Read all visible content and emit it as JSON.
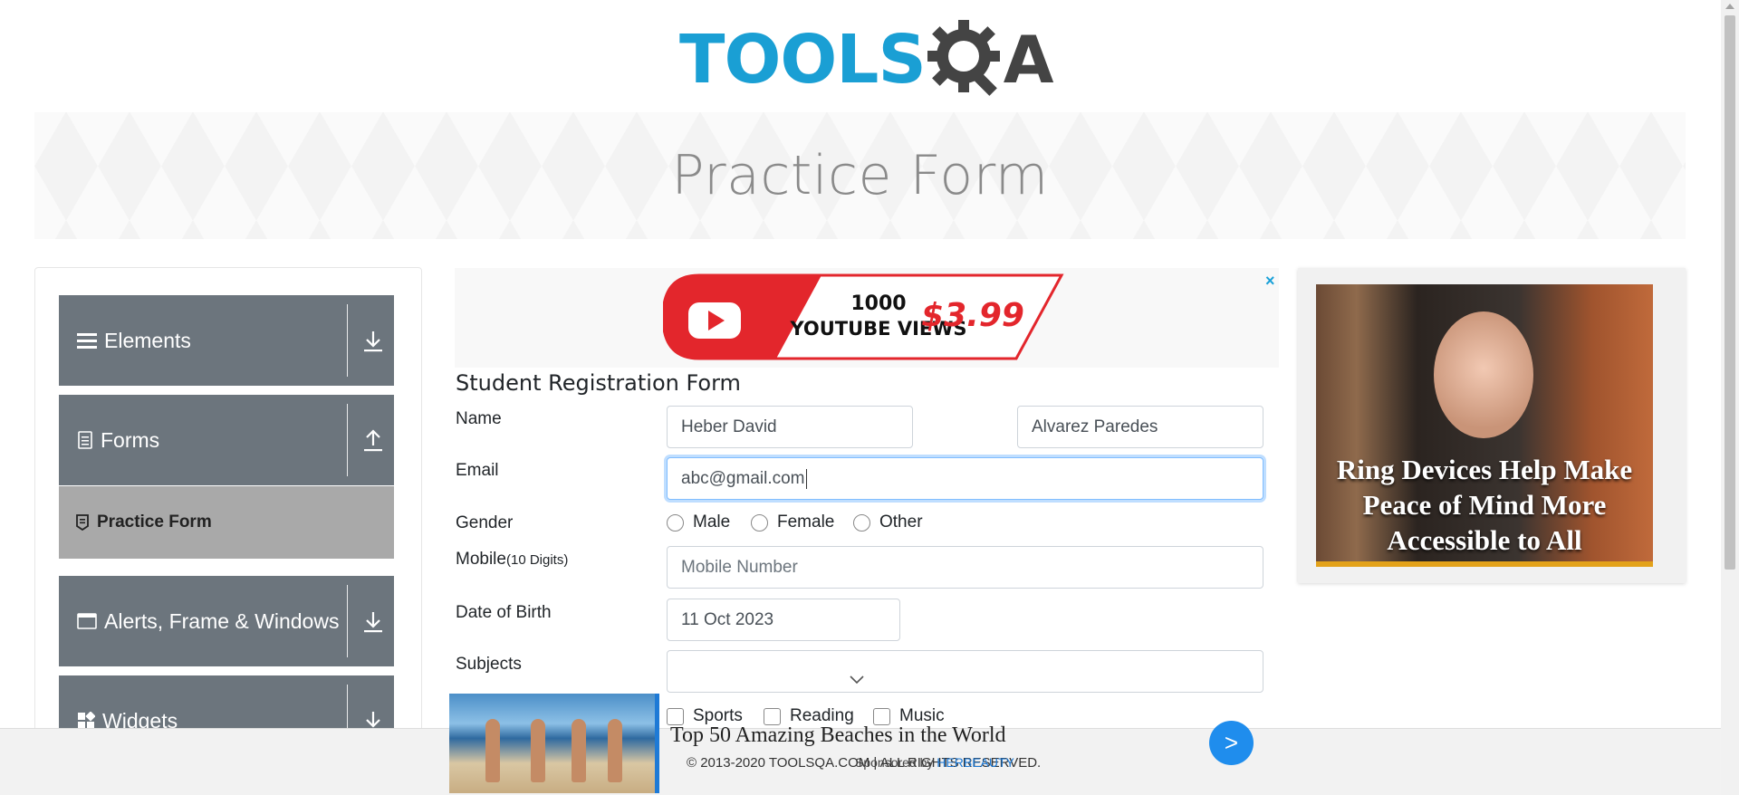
{
  "header": {
    "logo_tools": "TOOLS",
    "logo_a": "A",
    "logo_icon": "gear-magnifier-icon"
  },
  "banner": {
    "title": "Practice Form"
  },
  "sidebar": {
    "groups": [
      {
        "label": "Elements",
        "icon": "hamburger-icon",
        "state_icon": "download-arrow-icon"
      },
      {
        "label": "Forms",
        "icon": "document-icon",
        "state_icon": "upload-arrow-icon"
      },
      {
        "label": "Alerts, Frame & Windows",
        "icon": "window-icon",
        "state_icon": "download-arrow-icon"
      },
      {
        "label": "Widgets",
        "icon": "widgets-icon",
        "state_icon": "download-arrow-icon"
      }
    ],
    "active_item": {
      "label": "Practice Form",
      "icon": "badge-icon"
    }
  },
  "top_ad": {
    "close": "×",
    "line1": "1000",
    "line2": "YOUTUBE VIEWS",
    "price": "$3.99"
  },
  "form": {
    "title": "Student Registration Form",
    "name_label": "Name",
    "first_name": "Heber David",
    "last_name": "Alvarez Paredes",
    "email_label": "Email",
    "email": "abc@gmail.com",
    "gender_label": "Gender",
    "gender_options": [
      "Male",
      "Female",
      "Other"
    ],
    "mobile_label": "Mobile",
    "mobile_hint": "(10 Digits)",
    "mobile_placeholder": "Mobile Number",
    "dob_label": "Date of Birth",
    "dob": "11 Oct 2023",
    "subjects_label": "Subjects",
    "hobbies": [
      "Sports",
      "Reading",
      "Music"
    ]
  },
  "right_ad": {
    "caption": "Ring Devices Help Make Peace of Mind More Accessible to All"
  },
  "bottom_ad": {
    "title": "Top 50 Amazing Beaches in the World",
    "go": ">",
    "sponsored_prefix": "Sponsored by",
    "sponsored_brand": "HERBEAUTY"
  },
  "footer": {
    "text": "© 2013-2020 TOOLSQA.COM | ALL RIGHTS RESERVED."
  },
  "colors": {
    "brand_blue": "#1a9fd4",
    "sidebar_gray": "#6c757d",
    "active_item": "#a9a9a9",
    "focus_border": "#80bdff"
  }
}
